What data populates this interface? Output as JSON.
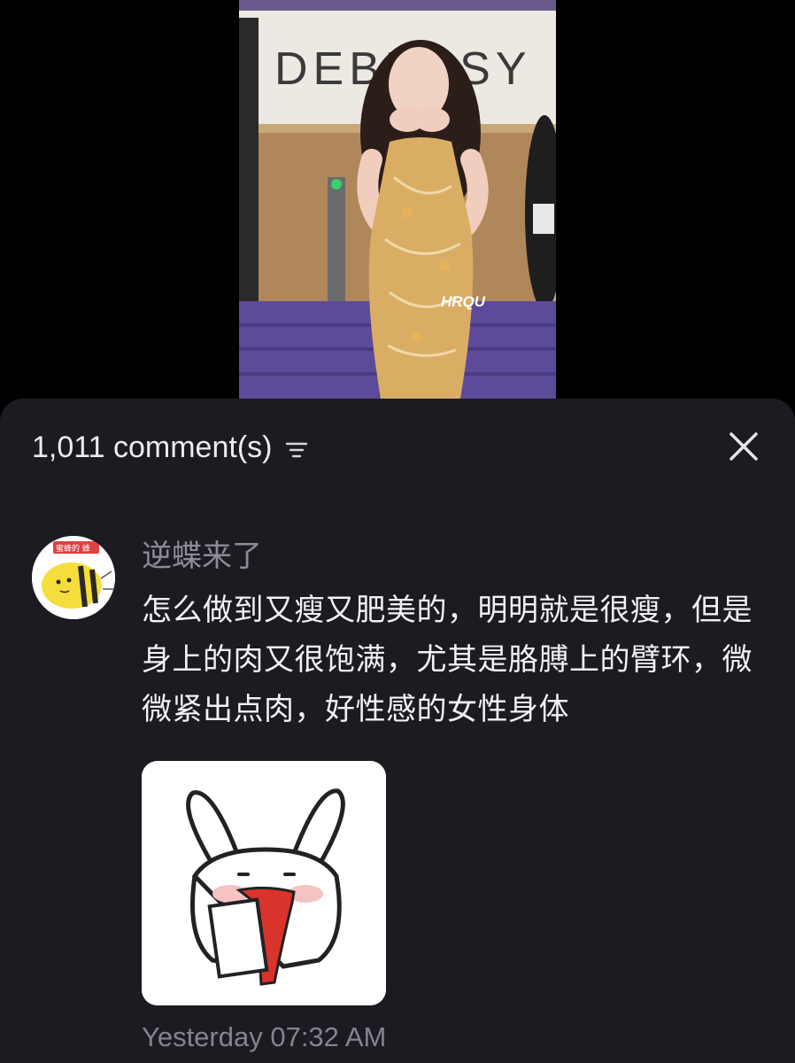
{
  "video": {
    "sign_text": "DEBUSSY",
    "watermark": "HRQU"
  },
  "comments_panel": {
    "count_label": "1,011 comment(s)",
    "sort_icon": "sort-icon",
    "close_icon": "close-icon"
  },
  "comment": {
    "username": "逆蝶来了",
    "avatar_badge": "蜜蜂的 蜂",
    "text": "怎么做到又瘦又肥美的，明明就是很瘦，但是身上的肉又很饱满，尤其是胳膊上的臂环，微微紧出点肉，好性感的女性身体",
    "sticker_icon": "bunny-sticker",
    "timestamp": "Yesterday 07:32 AM"
  }
}
